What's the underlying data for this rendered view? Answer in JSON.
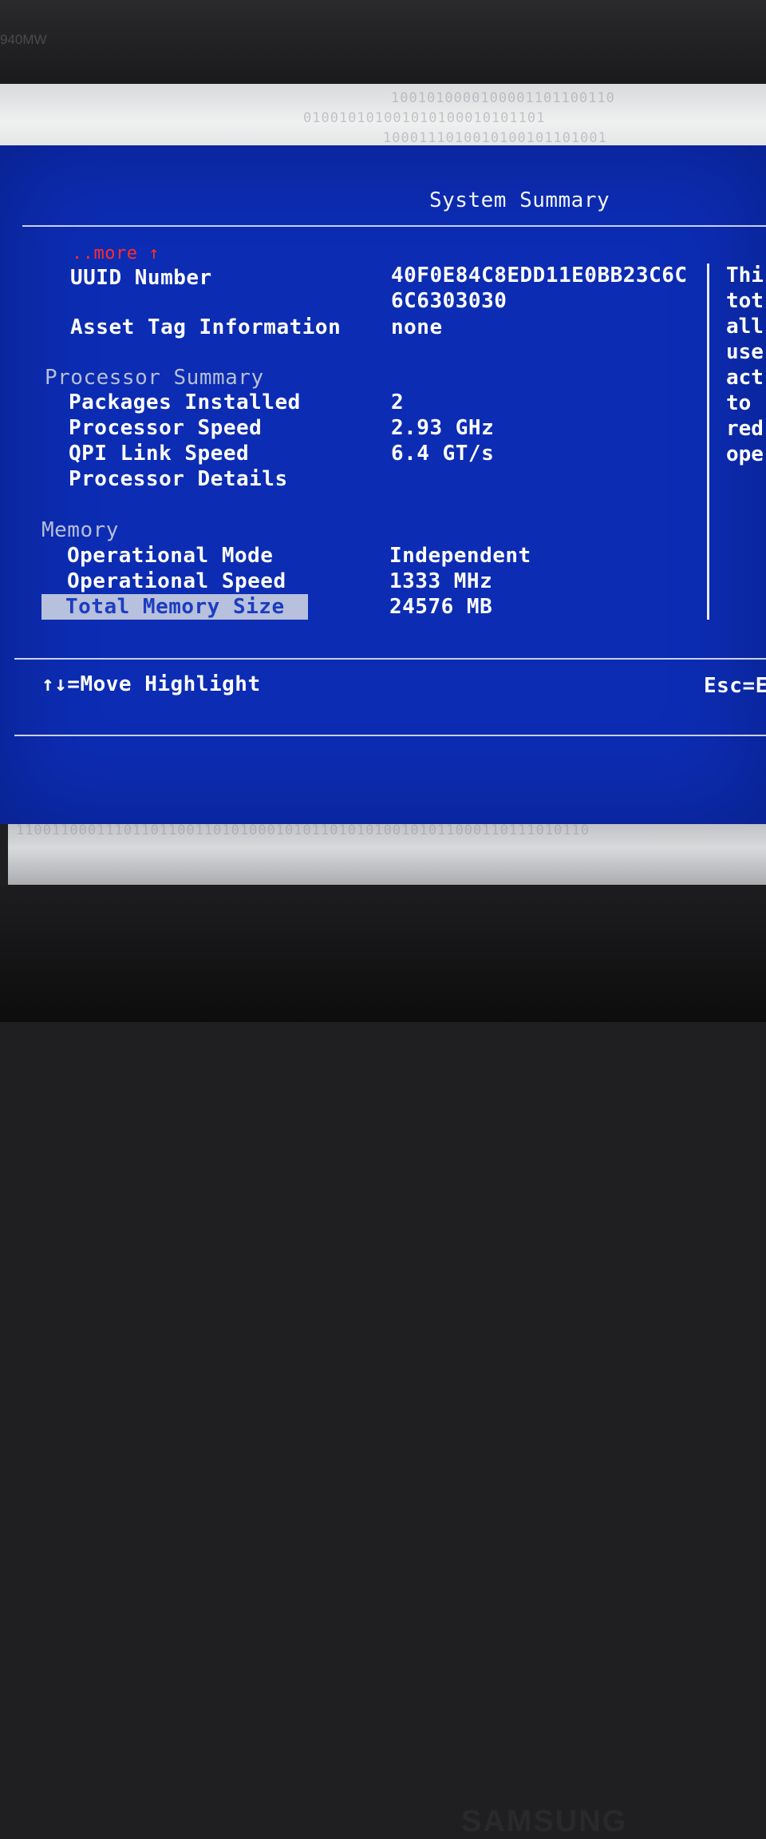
{
  "bezel": {
    "model": "940MW",
    "brand": "SAMSUNG"
  },
  "edge_binary": {
    "top_line1": "1001010000100001101100110",
    "top_line2": "010010101001010100010101101",
    "top_line3": "1000111010010100101101001",
    "bottom_line": "1100110001110110110011010100010101101010100101011000110111010110"
  },
  "screen": {
    "title": "System Summary",
    "more_link": "..more ↑",
    "uuid": {
      "label": "UUID Number",
      "value_line1": "40F0E84C8EDD11E0BB23C6C",
      "value_line2": "6C6303030"
    },
    "asset_tag": {
      "label": "Asset Tag Information",
      "value": "none"
    },
    "processor_summary": {
      "heading": "Processor Summary",
      "rows": [
        {
          "label": "Packages Installed",
          "value": "2"
        },
        {
          "label": "Processor Speed",
          "value": "2.93 GHz"
        },
        {
          "label": "QPI Link Speed",
          "value": "6.4 GT/s"
        },
        {
          "label": "Processor Details",
          "value": ""
        }
      ]
    },
    "memory": {
      "heading": "Memory",
      "rows": [
        {
          "label": "Operational Mode",
          "value": "Independent"
        },
        {
          "label": "Operational Speed",
          "value": "1333 MHz"
        },
        {
          "label": "Total Memory Size",
          "value": "24576 MB"
        }
      ]
    },
    "help_lines": [
      "Thi",
      "tot",
      "all",
      "use",
      "act",
      "to",
      "red",
      "ope"
    ],
    "footer": {
      "move_hint": "↑↓=Move Highlight",
      "esc_hint": "Esc=E"
    }
  },
  "colors": {
    "screen_bg": "#0c2cb3",
    "text": "#ffffff",
    "dim": "#b7bfd8",
    "more": "#ff2d2d",
    "highlight_bg": "#b7c0dc"
  }
}
